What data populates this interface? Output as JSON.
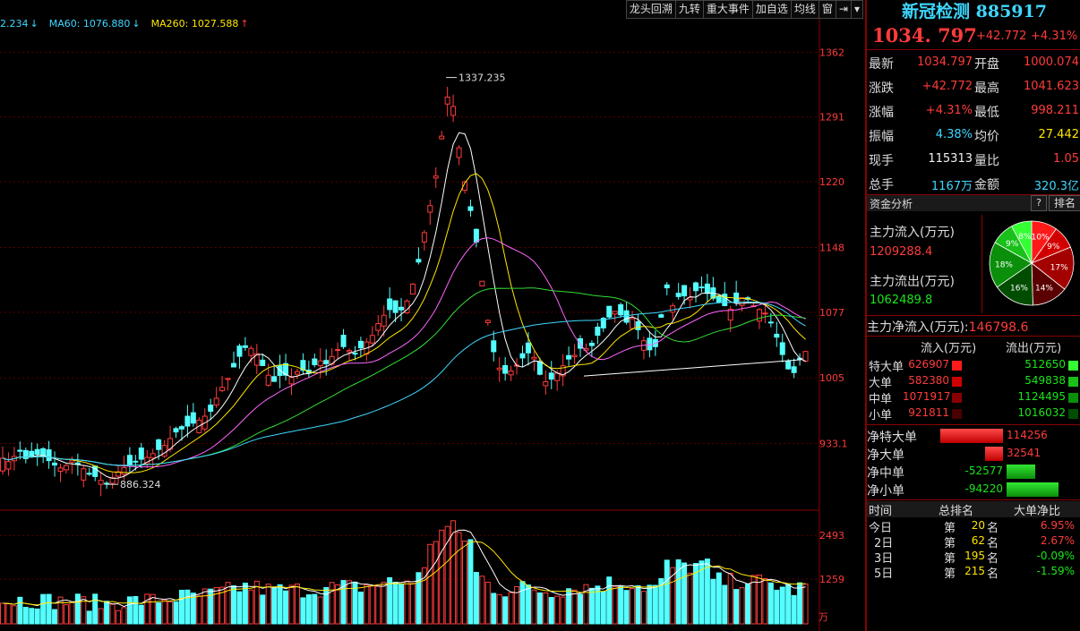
{
  "toolbar": {
    "items": [
      "龙头回溯",
      "九转",
      "重大事件",
      "加自选",
      "均线",
      "窗",
      "⇥",
      "▾"
    ]
  },
  "ma_legend": [
    {
      "text": "2.234",
      "arrow": "↓",
      "color": "#3fd7ff"
    },
    {
      "text": "MA60: 1076.880",
      "arrow": "↓",
      "color": "#3fd7ff"
    },
    {
      "text": "MA260: 1027.588",
      "arrow": "↑",
      "color": "#ffe600"
    }
  ],
  "price_axis": [
    "1362",
    "1291",
    "1220",
    "1148",
    "1077",
    "1005",
    "933.1"
  ],
  "volume_axis": [
    "2493",
    "1259"
  ],
  "volume_unit": "万",
  "annotations": {
    "high": "1337.235",
    "low": "886.324"
  },
  "chart_data": {
    "type": "candlestick",
    "price_range": [
      860,
      1380
    ],
    "volume_range": [
      0,
      2700
    ],
    "high_label": 1337.235,
    "low_label": 886.324
  },
  "panel": {
    "title": "新冠检测 885917",
    "price": "1034. 797",
    "change": "+42.772",
    "change_pct": "+4.31%",
    "stats": [
      {
        "l1": "最新",
        "v1": "1034.797",
        "c1": "red",
        "l2": "开盘",
        "v2": "1000.074",
        "c2": "red"
      },
      {
        "l1": "涨跌",
        "v1": "+42.772",
        "c1": "red",
        "l2": "最高",
        "v2": "1041.623",
        "c2": "red"
      },
      {
        "l1": "涨幅",
        "v1": "+4.31%",
        "c1": "red",
        "l2": "最低",
        "v2": "998.211",
        "c2": "red"
      },
      {
        "l1": "振幅",
        "v1": "4.38%",
        "c1": "cyan",
        "l2": "均价",
        "v2": "27.442",
        "c2": "yellow"
      },
      {
        "l1": "现手",
        "v1": "115313",
        "c1": "white",
        "l2": "量比",
        "v2": "1.05",
        "c2": "red"
      },
      {
        "l1": "总手",
        "v1": "1167万",
        "c1": "cyan",
        "l2": "金额",
        "v2": "320.3亿",
        "c2": "cyan"
      }
    ],
    "fund_title": "资金分析",
    "fund_q": "?",
    "fund_rank": "排名",
    "main_in_label": "主力流入(万元)",
    "main_in_value": "1209288.4",
    "main_out_label": "主力流出(万元)",
    "main_out_value": "1062489.8",
    "net_label": "主力净流入(万元):",
    "net_value": "146798.6",
    "pie": [
      {
        "label": "10%",
        "value": 10,
        "color": "#ff1a1a"
      },
      {
        "label": "9%",
        "value": 9,
        "color": "#d10000"
      },
      {
        "label": "17%",
        "value": 17,
        "color": "#a30000"
      },
      {
        "label": "14%",
        "value": 14,
        "color": "#5a0000"
      },
      {
        "label": "16%",
        "value": 16,
        "color": "#004d00"
      },
      {
        "label": "18%",
        "value": 18,
        "color": "#0b8f0b"
      },
      {
        "label": "9%",
        "value": 9,
        "color": "#19c019"
      },
      {
        "label": "8%",
        "value": 8,
        "color": "#33ff33"
      }
    ],
    "flow_header": {
      "in": "流入(万元)",
      "out": "流出(万元)"
    },
    "flows": [
      {
        "name": "特大单",
        "in": "626907",
        "out": "512650"
      },
      {
        "name": "大单",
        "in": "582380",
        "out": "549838"
      },
      {
        "name": "中单",
        "in": "1071917",
        "out": "1124495"
      },
      {
        "name": "小单",
        "in": "921811",
        "out": "1016032"
      }
    ],
    "nets": [
      {
        "name": "净特大单",
        "value": "114256",
        "num": 114256
      },
      {
        "name": "净大单",
        "value": "32541",
        "num": 32541
      },
      {
        "name": "净中单",
        "value": "-52577",
        "num": -52577
      },
      {
        "name": "净小单",
        "value": "-94220",
        "num": -94220
      }
    ],
    "rank_header": {
      "time": "时间",
      "rank": "总排名",
      "ratio": "大单净比"
    },
    "ranks": [
      {
        "time": "今日",
        "pre": "第",
        "num": "20",
        "post": "名",
        "ratio": "6.95%",
        "c": "red"
      },
      {
        "time": "2日",
        "pre": "第",
        "num": "62",
        "post": "名",
        "ratio": "2.67%",
        "c": "red"
      },
      {
        "time": "3日",
        "pre": "第",
        "num": "195",
        "post": "名",
        "ratio": "-0.09%",
        "c": "green"
      },
      {
        "time": "5日",
        "pre": "第",
        "num": "215",
        "post": "名",
        "ratio": "-1.59%",
        "c": "green"
      }
    ]
  }
}
